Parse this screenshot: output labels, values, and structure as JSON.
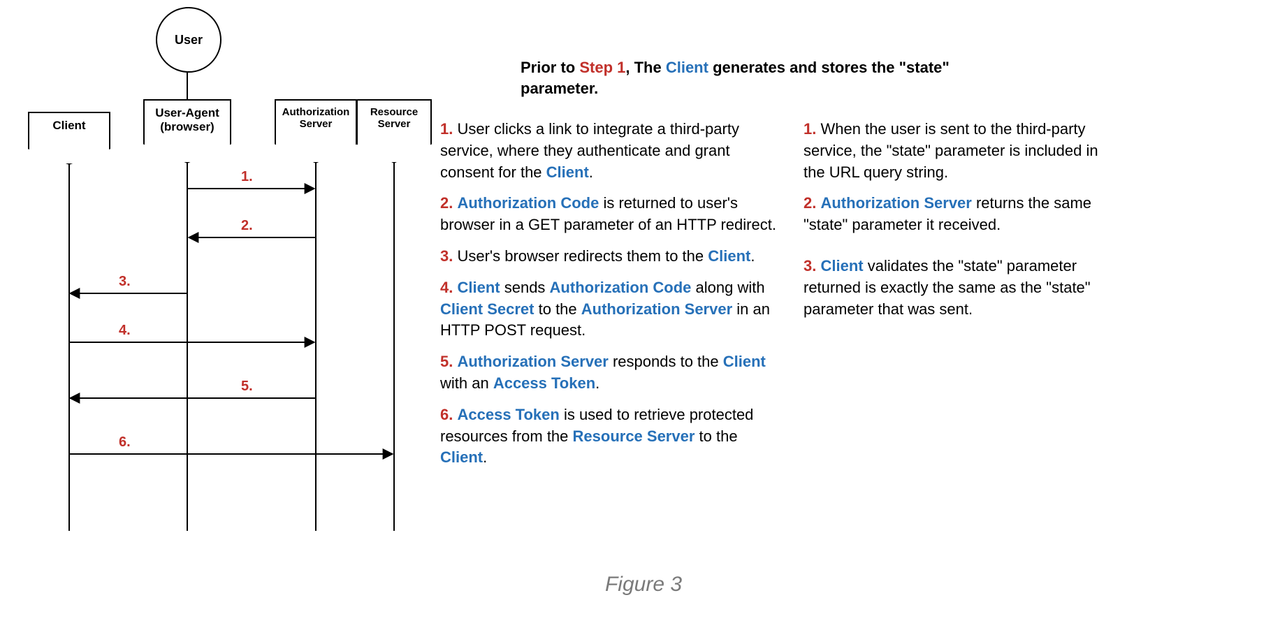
{
  "diagram": {
    "actors": {
      "user": "User",
      "client": "Client",
      "user_agent_l1": "User-Agent",
      "user_agent_l2": "(browser)",
      "auth_l1": "Authorization",
      "auth_l2": "Server",
      "resource_l1": "Resource",
      "resource_l2": "Server"
    },
    "arrow_labels": {
      "n1": "1.",
      "n2": "2.",
      "n3": "3.",
      "n4": "4.",
      "n5": "5.",
      "n6": "6."
    }
  },
  "intro": {
    "pre": "Prior to ",
    "step1": "Step 1",
    "mid": ", The ",
    "client": "Client",
    "post": " generates and stores the \"state\" parameter."
  },
  "left_steps": {
    "s1": {
      "num": "1.",
      "a": " User clicks a link to integrate a third-party service, where they authenticate and grant consent for the ",
      "client": "Client",
      "end": "."
    },
    "s2": {
      "num": "2.",
      "sp": " ",
      "code": "Authorization Code",
      "a": " is returned to user's browser in a GET parameter of an HTTP redirect."
    },
    "s3": {
      "num": "3.",
      "a": " User's browser redirects them to the ",
      "client": "Client",
      "end": "."
    },
    "s4": {
      "num": "4.",
      "sp": " ",
      "client": "Client",
      "a": " sends ",
      "code": "Authorization Code",
      "b": " along with ",
      "secret": "Client Secret",
      "c": " to the ",
      "auth": "Authorization Server",
      "d": " in an HTTP POST request."
    },
    "s5": {
      "num": "5.",
      "sp": " ",
      "auth": "Authorization Server",
      "a": " responds to the ",
      "client": "Client",
      "b": " with an ",
      "token": "Access Token",
      "end": "."
    },
    "s6": {
      "num": "6.",
      "sp": " ",
      "token": "Access Token",
      "a": " is used to retrieve protected resources from the ",
      "res": "Resource Server",
      "b": " to the ",
      "client": "Client",
      "end": "."
    }
  },
  "right_steps": {
    "s1": {
      "num": "1.",
      "a": " When the user is sent to the third-party service, the \"state\" parameter is included in the URL query string."
    },
    "s2": {
      "num": "2.",
      "sp": " ",
      "auth": "Authorization Server",
      "a": " returns the same \"state\" parameter it received."
    },
    "s3": {
      "num": "3.",
      "sp": " ",
      "client": "Client",
      "a": " validates the \"state\" parameter returned is exactly the same as the \"state\" parameter that was sent."
    }
  },
  "caption": "Figure 3"
}
